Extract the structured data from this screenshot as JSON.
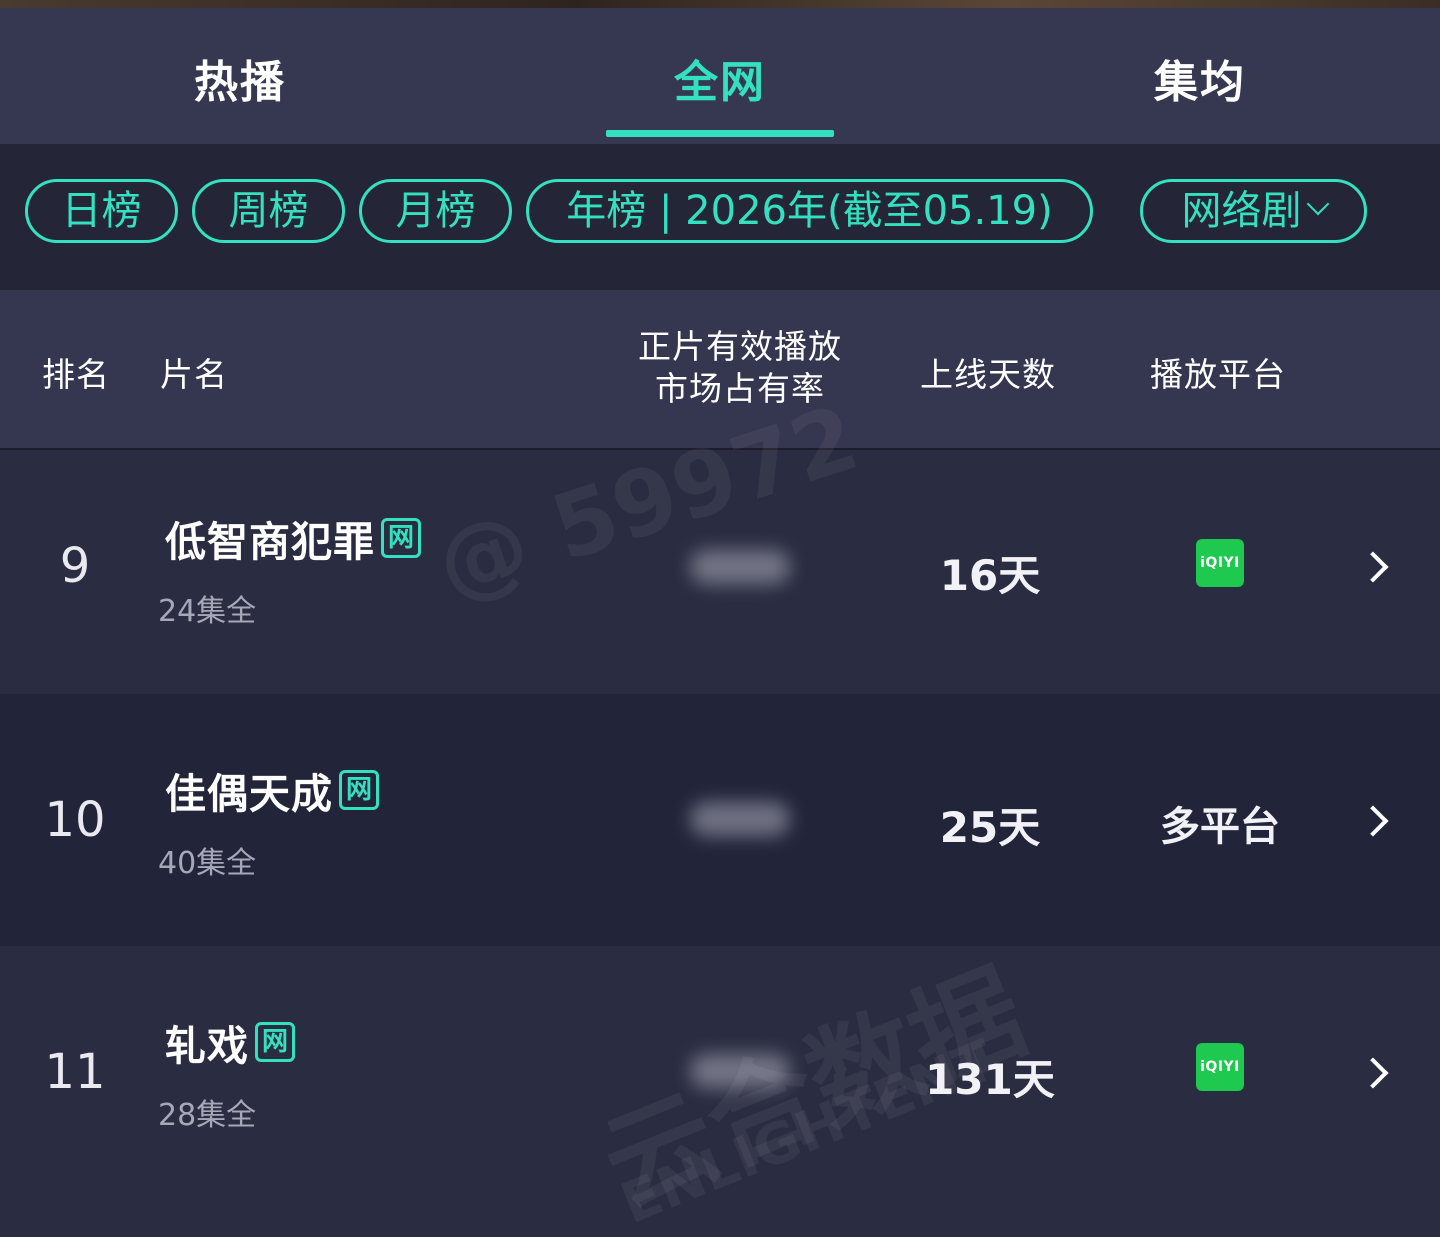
{
  "tabs": [
    {
      "label": "热播",
      "active": false
    },
    {
      "label": "全网",
      "active": true
    },
    {
      "label": "集均",
      "active": false
    }
  ],
  "filters": {
    "daily": "日榜",
    "weekly": "周榜",
    "monthly": "月榜",
    "yearly": "年榜 | 2026年(截至05.19)",
    "category": "网络剧"
  },
  "header": {
    "rank": "排名",
    "title": "片名",
    "share_line1": "正片有效播放",
    "share_line2": "市场占有率",
    "days": "上线天数",
    "platform": "播放平台"
  },
  "rows": [
    {
      "rank": "9",
      "title": "低智商犯罪",
      "badge": "网",
      "episodes": "24集全",
      "days": "16天",
      "platform": "iQIYI",
      "platform_icon": "iqiyi-logo-icon"
    },
    {
      "rank": "10",
      "title": "佳偶天成",
      "badge": "网",
      "episodes": "40集全",
      "days": "25天",
      "platform": "多平台"
    },
    {
      "rank": "11",
      "title": "轧戏",
      "badge": "网",
      "episodes": "28集全",
      "days": "131天",
      "platform": "iQIYI",
      "platform_icon": "iqiyi-logo-icon"
    }
  ],
  "watermarks": {
    "user": "@ 59972",
    "brand": "云合数据",
    "brand_en": "ENLIGHTENT"
  },
  "colors": {
    "accent": "#33e0c0",
    "iqiyi": "#1fc84e",
    "background": "#2a2c40"
  }
}
